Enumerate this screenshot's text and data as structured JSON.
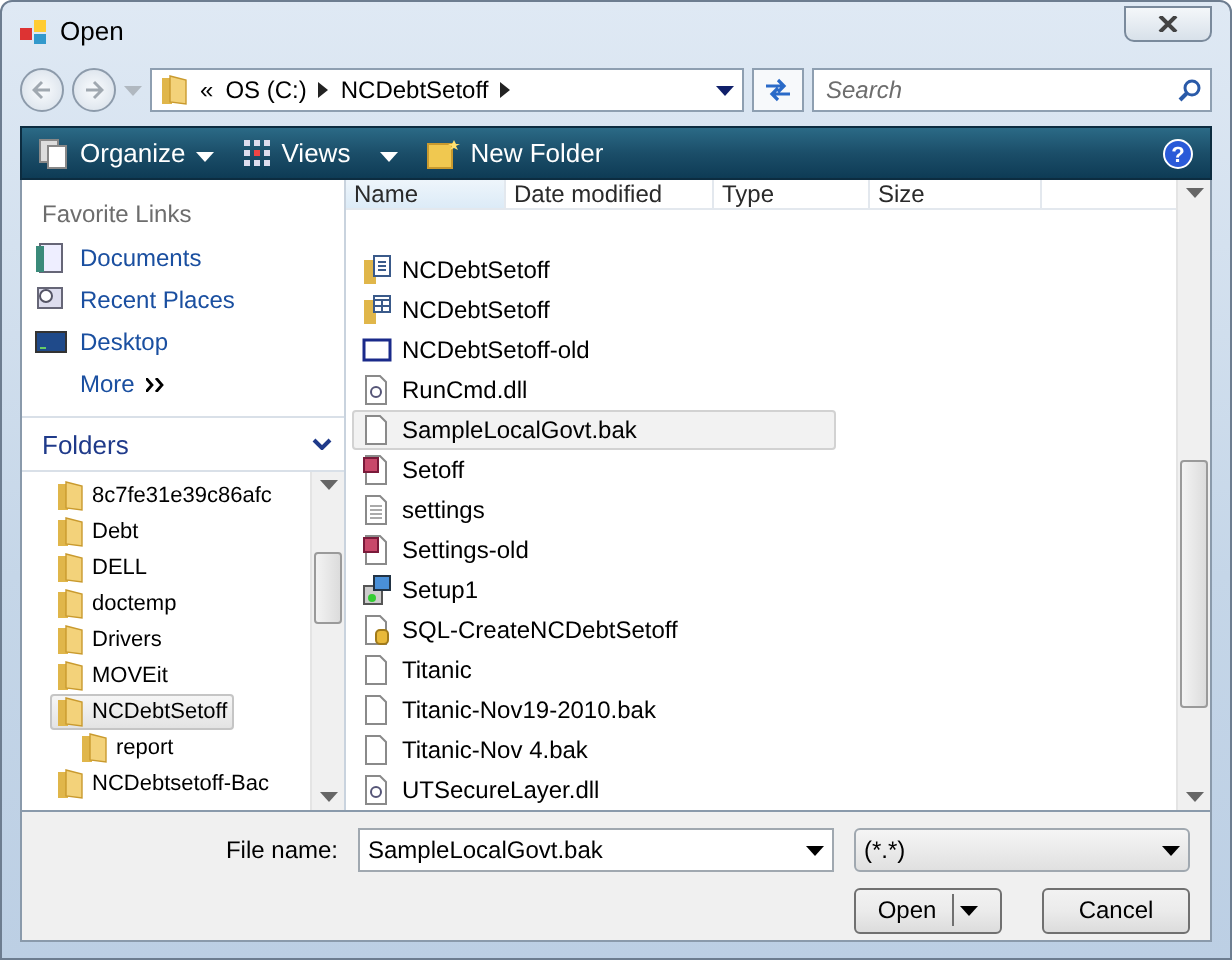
{
  "window": {
    "title": "Open"
  },
  "address": {
    "crumbs": [
      "«",
      "OS (C:)",
      "NCDebtSetoff"
    ]
  },
  "search": {
    "placeholder": "Search"
  },
  "help_button": {
    "label": "?"
  },
  "toolbar": [
    {
      "label": "Organize",
      "kind": "organize"
    },
    {
      "label": "Views",
      "kind": "views"
    },
    {
      "label": "New Folder",
      "kind": "newfolder"
    }
  ],
  "favorites": {
    "title": "Favorite Links",
    "items": [
      {
        "label": "Documents",
        "kind": "documents"
      },
      {
        "label": "Recent Places",
        "kind": "recent"
      },
      {
        "label": "Desktop",
        "kind": "desktop"
      },
      {
        "label": "More",
        "kind": "more"
      }
    ]
  },
  "folders": {
    "title": "Folders",
    "items": [
      {
        "label": "8c7fe31e39c86afc",
        "selected": false
      },
      {
        "label": "Debt",
        "selected": false
      },
      {
        "label": "DELL",
        "selected": false
      },
      {
        "label": "doctemp",
        "selected": false
      },
      {
        "label": "Drivers",
        "selected": false
      },
      {
        "label": "MOVEit",
        "selected": false
      },
      {
        "label": "NCDebtSetoff",
        "selected": true,
        "children": [
          {
            "label": "report",
            "selected": false
          }
        ]
      },
      {
        "label": "NCDebtsetoff-Bac",
        "selected": false
      }
    ]
  },
  "columns": [
    "Name",
    "Date modified",
    "Type",
    "Size"
  ],
  "files": [
    {
      "name": "NCDebtSetoff",
      "kind": "project",
      "selected": false
    },
    {
      "name": "NCDebtSetoff",
      "kind": "solution",
      "selected": false
    },
    {
      "name": "NCDebtSetoff-old",
      "kind": "window",
      "selected": false
    },
    {
      "name": "RunCmd.dll",
      "kind": "dll",
      "selected": false
    },
    {
      "name": "SampleLocalGovt.bak",
      "kind": "blank",
      "selected": true
    },
    {
      "name": "Setoff",
      "kind": "access",
      "selected": false
    },
    {
      "name": "settings",
      "kind": "text",
      "selected": false
    },
    {
      "name": "Settings-old",
      "kind": "access",
      "selected": false
    },
    {
      "name": "Setup1",
      "kind": "setup",
      "selected": false
    },
    {
      "name": "SQL-CreateNCDebtSetoff",
      "kind": "sql",
      "selected": false
    },
    {
      "name": "Titanic",
      "kind": "blank",
      "selected": false
    },
    {
      "name": "Titanic-Nov19-2010.bak",
      "kind": "blank",
      "selected": false
    },
    {
      "name": "Titanic-Nov 4.bak",
      "kind": "blank",
      "selected": false
    },
    {
      "name": "UTSecureLayer.dll",
      "kind": "dll",
      "selected": false
    }
  ],
  "file_name": {
    "label": "File name:",
    "value": "SampleLocalGovt.bak"
  },
  "file_type": {
    "value": "(*.*)"
  },
  "buttons": [
    {
      "label": "Open",
      "kind": "split"
    },
    {
      "label": "Cancel",
      "kind": "plain"
    }
  ]
}
